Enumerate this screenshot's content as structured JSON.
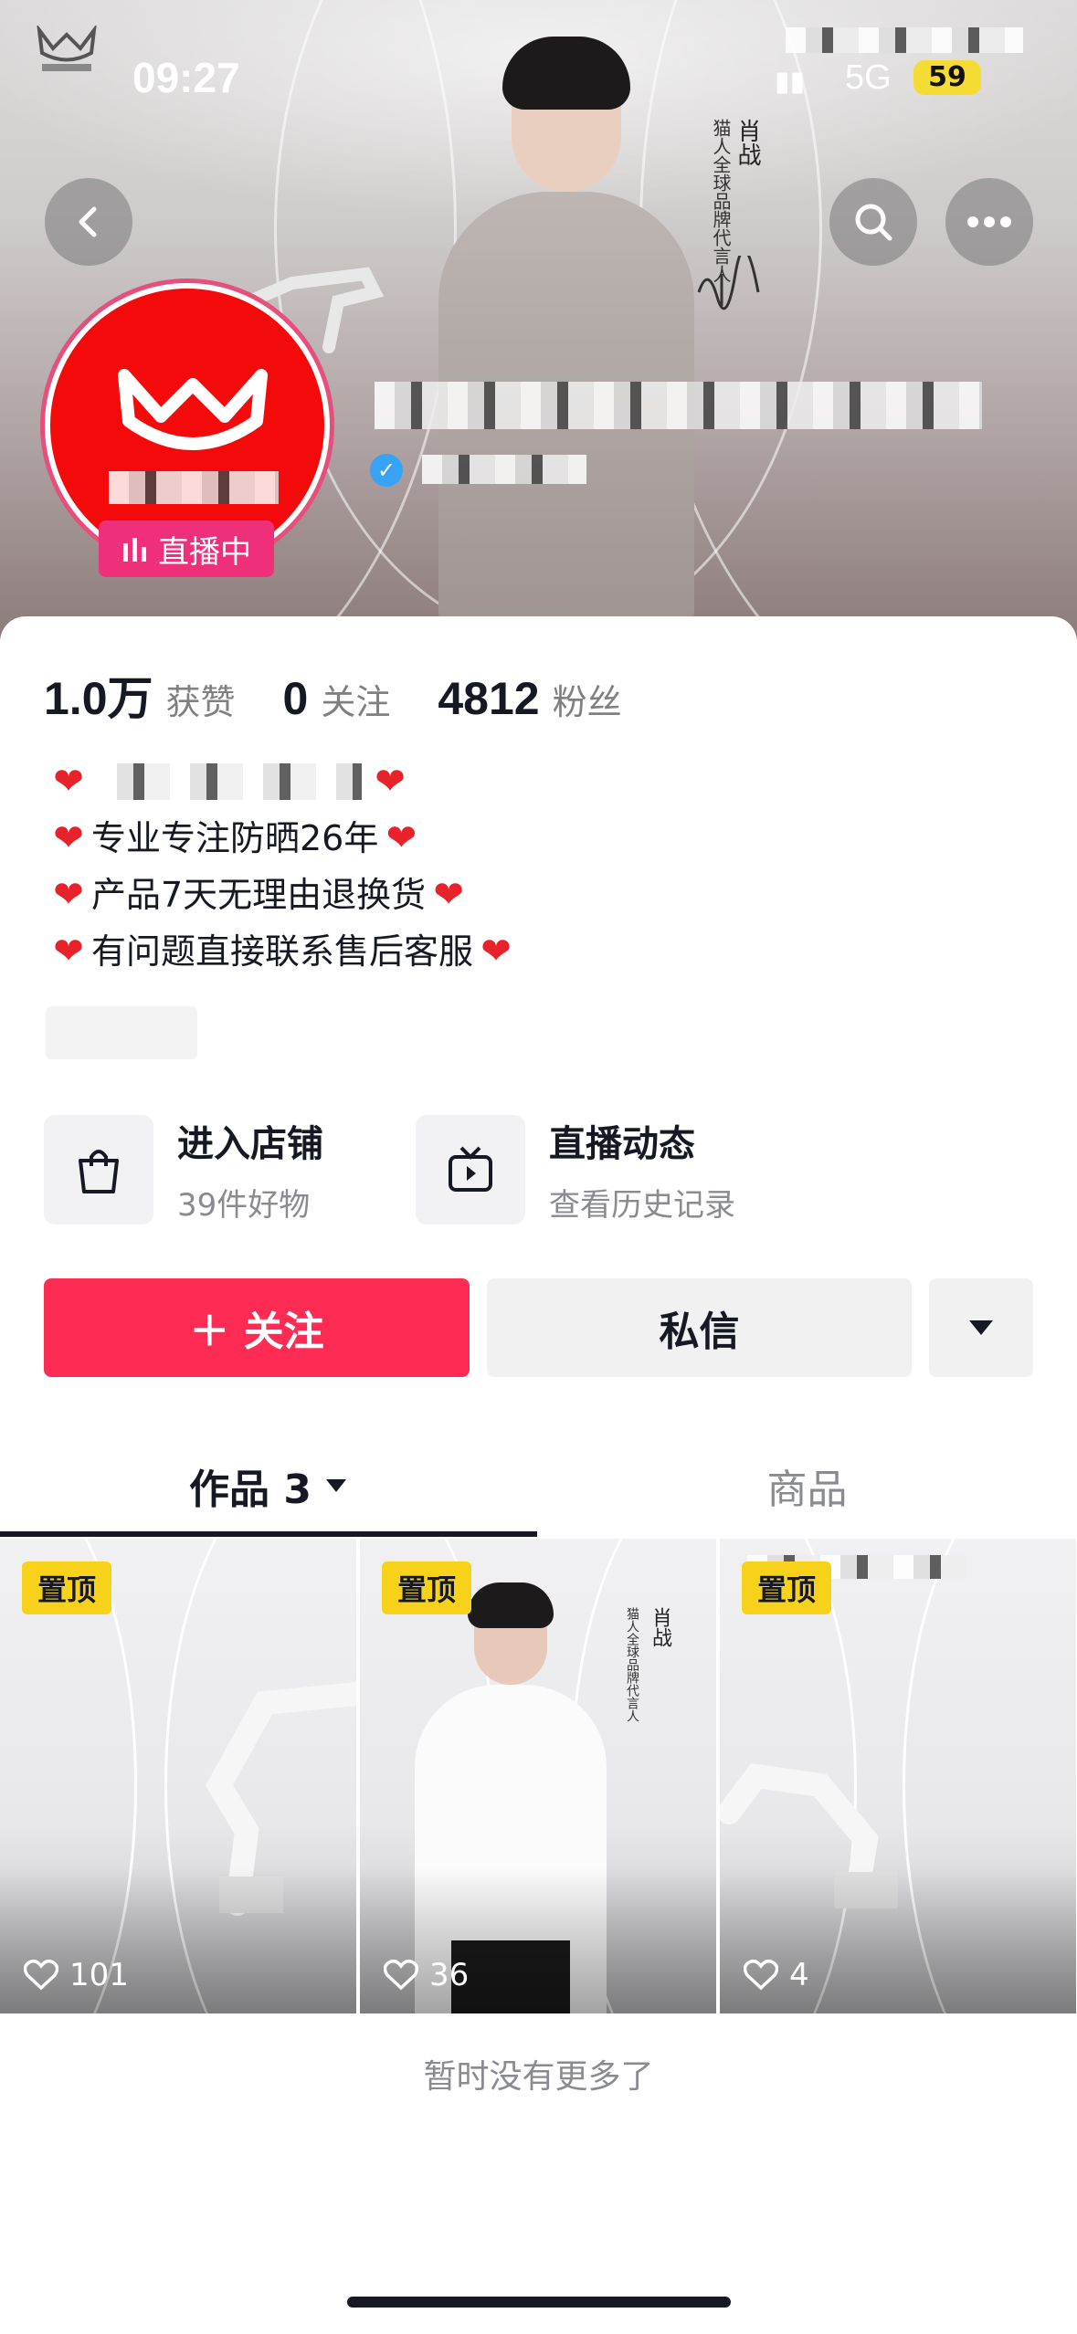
{
  "status": {
    "time": "09:27",
    "network": "5G",
    "battery": "59"
  },
  "banner": {
    "endorser_name": "肖战",
    "endorser_title": "猫人全球品牌代言人"
  },
  "profile": {
    "live_badge": "直播中"
  },
  "stats": [
    {
      "value": "1.0万",
      "label": "获赞"
    },
    {
      "value": "0",
      "label": "关注"
    },
    {
      "value": "4812",
      "label": "粉丝"
    }
  ],
  "bio": {
    "line2": "专业专注防晒26年",
    "line3": "产品7天无理由退换货",
    "line4": "有问题直接联系售后客服"
  },
  "shortcuts": {
    "shop": {
      "title": "进入店铺",
      "sub": "39件好物"
    },
    "live": {
      "title": "直播动态",
      "sub": "查看历史记录"
    }
  },
  "actions": {
    "follow": "＋ 关注",
    "message": "私信"
  },
  "tabs": {
    "works": "作品 3",
    "goods": "商品"
  },
  "videos": [
    {
      "pin": "置顶",
      "likes": "101"
    },
    {
      "pin": "置顶",
      "likes": "36"
    },
    {
      "pin": "置顶",
      "likes": "4"
    }
  ],
  "footer": {
    "no_more": "暂时没有更多了"
  }
}
